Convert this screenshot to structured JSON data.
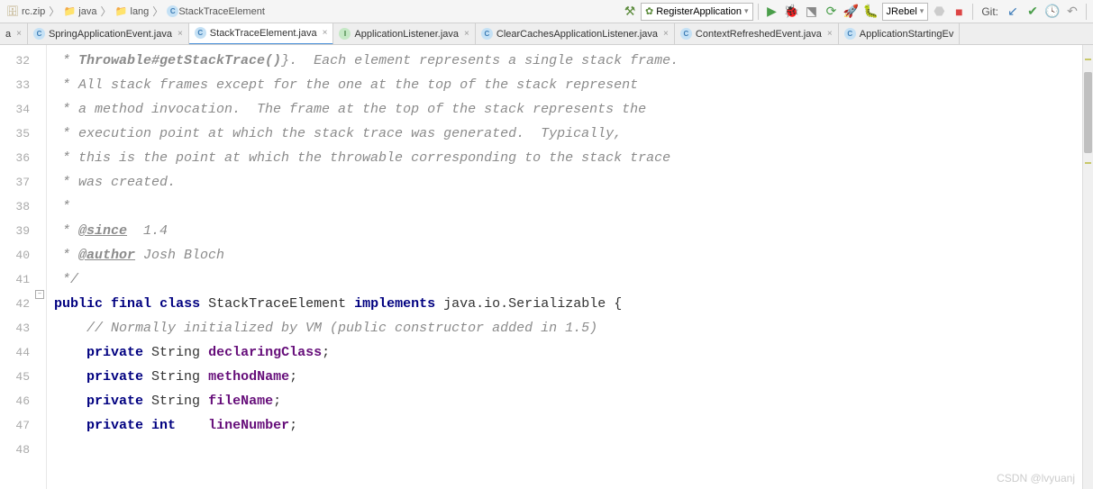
{
  "breadcrumb": [
    {
      "icon": "archive",
      "label": "rc.zip"
    },
    {
      "icon": "folder",
      "label": "java"
    },
    {
      "icon": "folder",
      "label": "lang"
    },
    {
      "icon": "class",
      "label": "StackTraceElement"
    }
  ],
  "toolbar": {
    "run_config": "RegisterApplication",
    "jrebel": "JRebel",
    "git_label": "Git:"
  },
  "tabs": [
    {
      "icon": "class",
      "label": "a",
      "partial": true
    },
    {
      "icon": "class",
      "label": "SpringApplicationEvent.java"
    },
    {
      "icon": "class",
      "label": "StackTraceElement.java",
      "active": true
    },
    {
      "icon": "interface",
      "label": "ApplicationListener.java"
    },
    {
      "icon": "class",
      "label": "ClearCachesApplicationListener.java"
    },
    {
      "icon": "class",
      "label": "ContextRefreshedEvent.java"
    },
    {
      "icon": "class",
      "label": "ApplicationStartingEv",
      "partial": true
    }
  ],
  "gutter": {
    "start": 32,
    "end": 48
  },
  "code": {
    "l32a": " * ",
    "l32b": "Throwable#getStackTrace()",
    "l32c": "}.  Each element represents a single stack frame.",
    "l33": " * All stack frames except for the one at the top of the stack represent",
    "l34": " * a method invocation.  The frame at the top of the stack represents the",
    "l35": " * execution point at which the stack trace was generated.  Typically,",
    "l36": " * this is the point at which the throwable corresponding to the stack trace",
    "l37": " * was created.",
    "l38": " *",
    "l39a": " * ",
    "l39b": "@since",
    "l39c": "  1.4",
    "l40a": " * ",
    "l40b": "@author",
    "l40c": " Josh Bloch",
    "l41": " */",
    "l42_kw1": "public",
    "l42_kw2": "final",
    "l42_kw3": "class",
    "l42_cls": "StackTraceElement",
    "l42_kw4": "implements",
    "l42_imp": "java.io.Serializable {",
    "l43": "    // Normally initialized by VM (public constructor added in 1.5)",
    "l44_kw": "private",
    "l44_type": "String",
    "l44_field": "declaringClass",
    "l45_kw": "private",
    "l45_type": "String",
    "l45_field": "methodName",
    "l46_kw": "private",
    "l46_type": "String",
    "l46_field": "fileName",
    "l47_kw": "private",
    "l47_type": "int   ",
    "l47_field": "lineNumber"
  },
  "watermark": "CSDN @lvyuanj"
}
